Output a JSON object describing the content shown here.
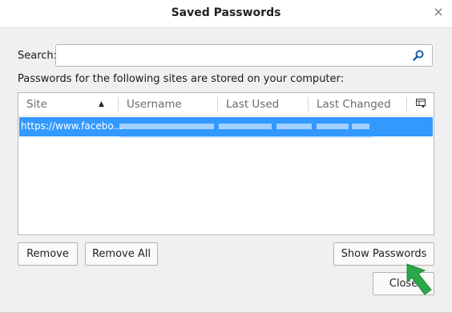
{
  "window": {
    "title": "Saved Passwords",
    "close_glyph": "×"
  },
  "search": {
    "label": "Search:",
    "value": "",
    "placeholder": "",
    "icon": "search-icon"
  },
  "info_text": "Passwords for the following sites are stored on your computer:",
  "table": {
    "columns": [
      {
        "label": "Site",
        "sorted": "ascending"
      },
      {
        "label": "Username"
      },
      {
        "label": "Last Used"
      },
      {
        "label": "Last Changed"
      }
    ],
    "column_picker_icon": "column-picker-icon",
    "rows": [
      {
        "site": "https://www.facebo...",
        "username": "(obscured)",
        "selected": true
      }
    ]
  },
  "buttons": {
    "remove": "Remove",
    "remove_all": "Remove All",
    "show_passwords": "Show Passwords",
    "close": "Close"
  },
  "colors": {
    "selection": "#3399ff",
    "annotation_arrow": "#2aa84a"
  }
}
